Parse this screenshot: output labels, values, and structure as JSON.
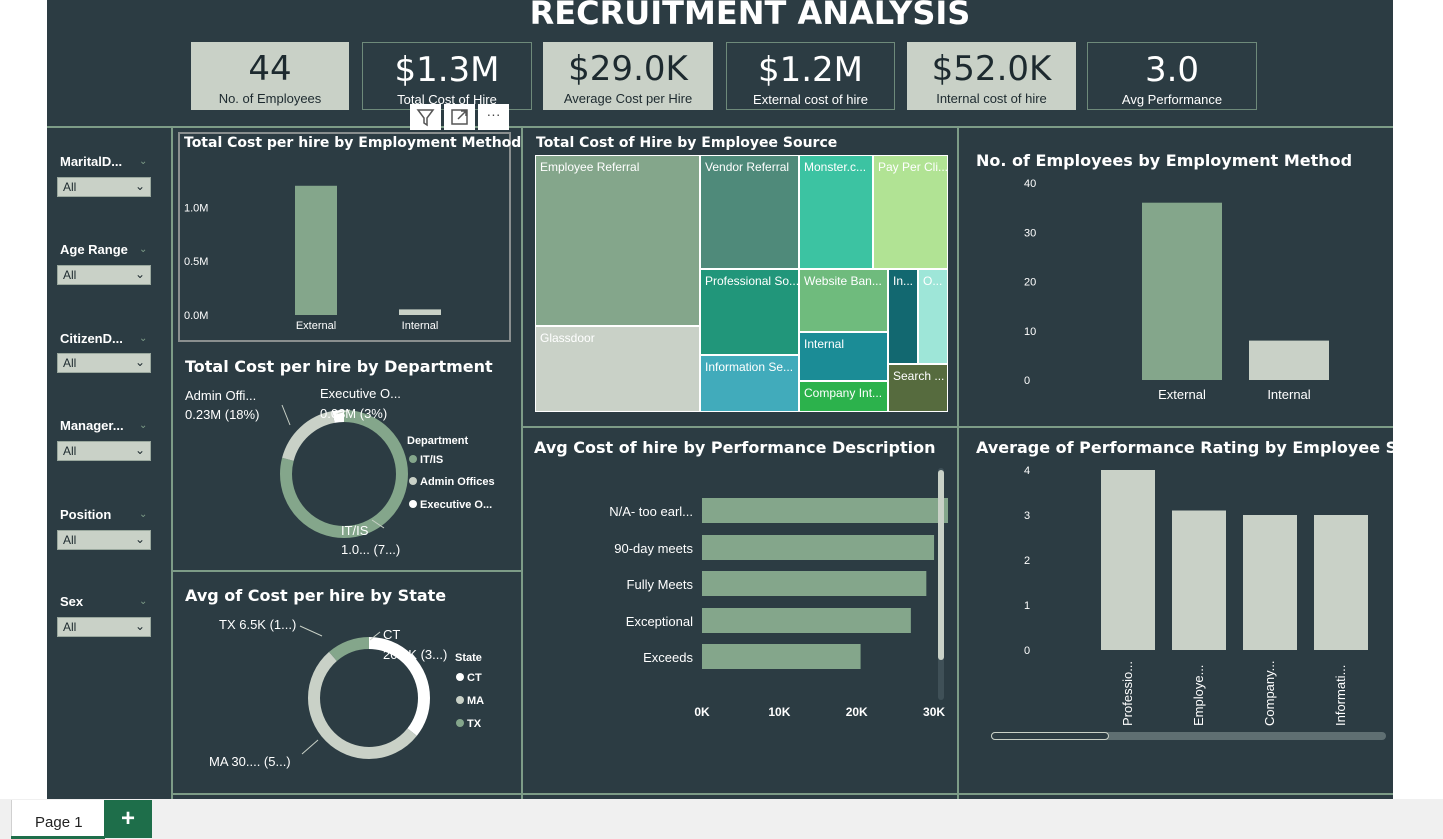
{
  "dashboard": {
    "title": "RECRUITMENT ANALYSIS"
  },
  "kpis": [
    {
      "value": "44",
      "label": "No. of Employees"
    },
    {
      "value": "$1.3M",
      "label": "Total Cost of Hire"
    },
    {
      "value": "$29.0K",
      "label": "Average Cost per Hire"
    },
    {
      "value": "$1.2M",
      "label": "External cost of hire"
    },
    {
      "value": "$52.0K",
      "label": "Internal cost of hire"
    },
    {
      "value": "3.0",
      "label": "Avg Performance"
    }
  ],
  "slicers": [
    {
      "label": "MaritalD...",
      "value": "All"
    },
    {
      "label": "Age Range",
      "value": "All"
    },
    {
      "label": "CitizenD...",
      "value": "All"
    },
    {
      "label": "Manager...",
      "value": "All"
    },
    {
      "label": "Position",
      "value": "All"
    },
    {
      "label": "Sex",
      "value": "All"
    }
  ],
  "visual_toolbar": {
    "filter_icon": "filter-icon",
    "focus_icon": "focus-mode-icon",
    "more_icon": "more-options-icon",
    "more_label": "···"
  },
  "colors": {
    "canvas": "#2c3c43",
    "green": "#84a68b",
    "light": "#c9d1c7",
    "border": "#7d9c87",
    "accent_tab": "#1e6e4a"
  },
  "charts": {
    "cost_by_method": {
      "title": "Total Cost per hire by Employment Method",
      "chart_data": {
        "type": "bar",
        "categories": [
          "External",
          "Internal"
        ],
        "values": [
          1200000,
          52000
        ],
        "ylim": [
          0,
          1300000
        ],
        "ytick_labels": [
          "0.0M",
          "0.5M",
          "1.0M"
        ],
        "yticks": [
          0,
          500000,
          1000000
        ]
      }
    },
    "cost_by_department": {
      "title": "Total Cost per hire by Department",
      "legend_title": "Department",
      "chart_data": {
        "type": "pie",
        "categories": [
          "IT/IS",
          "Admin Offices",
          "Executive O..."
        ],
        "values": [
          79,
          18,
          3
        ]
      },
      "labels": {
        "admin_1": "Admin Offi...",
        "admin_2": "0.23M (18%)",
        "exec_1": "Executive O...",
        "exec_2": "0.03M (3%)",
        "it_1": "IT/IS",
        "it_2": "1.0... (7...)"
      }
    },
    "cost_by_state": {
      "title": "Avg of Cost per hire by State",
      "legend_title": "State",
      "chart_data": {
        "type": "pie",
        "categories": [
          "CT",
          "MA",
          "TX"
        ],
        "values": [
          20.2,
          30.0,
          6.5
        ]
      },
      "labels": {
        "tx": "TX 6.5K (1...)",
        "ct_1": "CT",
        "ct_2": "20.2K (3...)",
        "ma": "MA 30.... (5...)"
      }
    },
    "cost_by_source": {
      "title": "Total Cost of Hire by Employee Source",
      "chart_data": {
        "type": "treemap",
        "categories": [
          "Employee Referral",
          "Glassdoor",
          "Vendor Referral",
          "Professional So...",
          "Information Se...",
          "Monster.c...",
          "Pay Per Cli...",
          "Website Ban...",
          "Internal",
          "Company Int...",
          "In...",
          "O...",
          "Search ..."
        ]
      }
    },
    "emp_by_method": {
      "title": "No. of Employees by Employment Method",
      "chart_data": {
        "type": "bar",
        "categories": [
          "External",
          "Internal"
        ],
        "values": [
          36,
          8
        ],
        "ylim": [
          0,
          40
        ],
        "yticks": [
          0,
          10,
          20,
          30,
          40
        ]
      }
    },
    "cost_by_performance": {
      "title": "Avg Cost of hire by Performance Description",
      "chart_data": {
        "type": "bar",
        "orientation": "horizontal",
        "categories": [
          "N/A- too earl...",
          "90-day meets",
          "Fully Meets",
          "Exceptional",
          "Exceeds"
        ],
        "values": [
          34000,
          30000,
          29000,
          27000,
          20500
        ],
        "xlim": [
          0,
          34000
        ],
        "xticks": [
          0,
          10000,
          20000,
          30000
        ],
        "xtick_labels": [
          "0K",
          "10K",
          "20K",
          "30K"
        ]
      }
    },
    "perf_by_source": {
      "title": "Average of Performance Rating by Employee Source",
      "chart_data": {
        "type": "bar",
        "categories": [
          "Professio...",
          "Employe...",
          "Company...",
          "Informati..."
        ],
        "values": [
          4.0,
          3.1,
          3.0,
          3.0
        ],
        "ylim": [
          0,
          4
        ],
        "yticks": [
          0,
          1,
          2,
          3,
          4
        ]
      }
    }
  },
  "tabs": {
    "page1": "Page 1",
    "add": "+"
  }
}
